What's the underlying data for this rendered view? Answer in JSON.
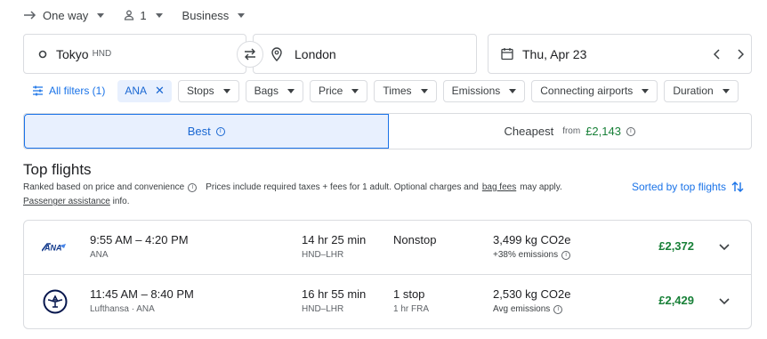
{
  "topbar": {
    "trip_type": "One way",
    "passengers": "1",
    "cabin": "Business"
  },
  "search": {
    "origin": "Tokyo",
    "origin_code": "HND",
    "destination": "London",
    "date": "Thu, Apr 23"
  },
  "filters": {
    "all_filters": "All filters (1)",
    "active_chip": "ANA",
    "chips": [
      "Stops",
      "Bags",
      "Price",
      "Times",
      "Emissions",
      "Connecting airports",
      "Duration"
    ]
  },
  "tabs": {
    "best": "Best",
    "cheapest": "Cheapest",
    "cheapest_from": "from",
    "cheapest_price": "£2,143"
  },
  "section": {
    "title": "Top flights",
    "ranked": "Ranked based on price and convenience",
    "prices_note_a": "Prices include required taxes + fees for 1 adult. Optional charges and",
    "bag_fees": "bag fees",
    "prices_note_b": "may apply.",
    "passenger_assistance": "Passenger assistance",
    "info_suffix": "info.",
    "sorted": "Sorted by top flights"
  },
  "flights": [
    {
      "times": "9:55 AM – 4:20 PM",
      "airline": "ANA",
      "duration": "14 hr 25 min",
      "route": "HND–LHR",
      "stops": "Nonstop",
      "stop_detail": "",
      "co2": "3,499 kg CO2e",
      "emissions": "+38% emissions",
      "price": "£2,372",
      "logo": "ana-logo"
    },
    {
      "times": "11:45 AM – 8:40 PM",
      "airline": "Lufthansa · ANA",
      "duration": "16 hr 55 min",
      "route": "HND–LHR",
      "stops": "1 stop",
      "stop_detail": "1 hr FRA",
      "co2": "2,530 kg CO2e",
      "emissions": "Avg emissions",
      "price": "£2,429",
      "logo": "lufthansa-logo"
    }
  ],
  "colors": {
    "accent": "#1a73e8",
    "price_green": "#188038",
    "ana_blue": "#133a8c"
  }
}
